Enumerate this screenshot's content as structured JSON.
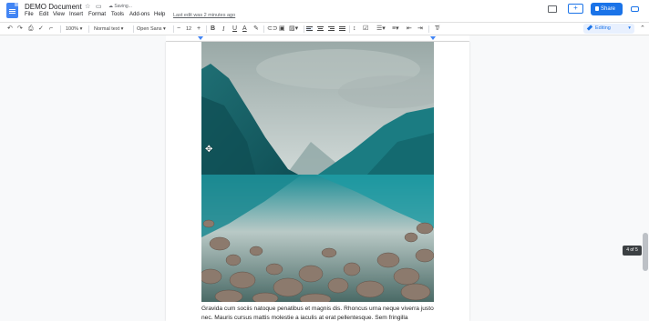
{
  "header": {
    "doc_title": "DEMO Document",
    "saving_status": "Saving...",
    "last_edit": "Last edit was 2 minutes ago",
    "share_label": "Share",
    "menus": [
      "File",
      "Edit",
      "View",
      "Insert",
      "Format",
      "Tools",
      "Add-ons",
      "Help"
    ]
  },
  "toolbar": {
    "zoom": "100%",
    "style": "Normal text",
    "font": "Open Sans",
    "font_size": "12",
    "mode": "Editing",
    "bold": "B",
    "italic": "I",
    "underline": "U",
    "text_color": "A",
    "decrease_font": "−",
    "increase_font": "+"
  },
  "document": {
    "body_text": "Gravida cum sociis natoque penatibus et magnis dis. Rhoncus urna neque viverra justo nec. Mauris cursus mattis molestie a iaculis at erat pellentesque. Sem fringilla"
  },
  "scroll": {
    "page_indicator": "4 of 5"
  },
  "colors": {
    "accent": "#1a73e8",
    "lake": "#1f8f97",
    "sky": "#c9d3d1"
  }
}
